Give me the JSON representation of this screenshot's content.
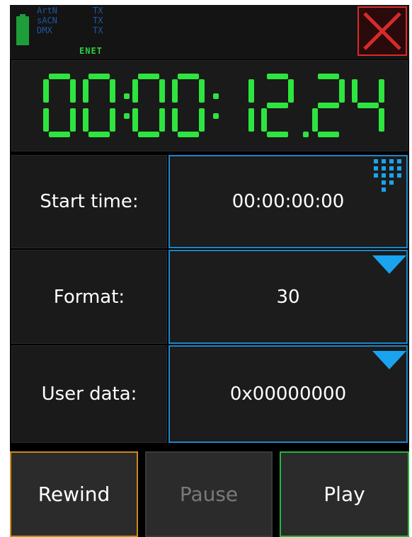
{
  "status": {
    "protocols": [
      {
        "name": "ArtN",
        "state": "TX"
      },
      {
        "name": "sACN",
        "state": "TX"
      },
      {
        "name": "DMX",
        "state": "TX"
      }
    ],
    "network": "ENET",
    "battery_icon": "battery-icon",
    "close_icon": "close-icon"
  },
  "timecode": {
    "display": "00:00:12.24",
    "color": "#2ee43f"
  },
  "rows": [
    {
      "label": "Start time:",
      "value": "00:00:00:00",
      "control_icon": "keypad-icon"
    },
    {
      "label": "Format:",
      "value": "30",
      "control_icon": "dropdown-triangle-icon"
    },
    {
      "label": "User data:",
      "value": "0x00000000",
      "control_icon": "dropdown-triangle-icon"
    }
  ],
  "buttons": {
    "rewind": "Rewind",
    "pause": "Pause",
    "play": "Play"
  },
  "colors": {
    "accent_blue": "#1e86c8",
    "icon_blue": "#1aa3ef",
    "rewind_border": "#c8891c",
    "play_border": "#27b33a",
    "close_red": "#d72b2b"
  }
}
